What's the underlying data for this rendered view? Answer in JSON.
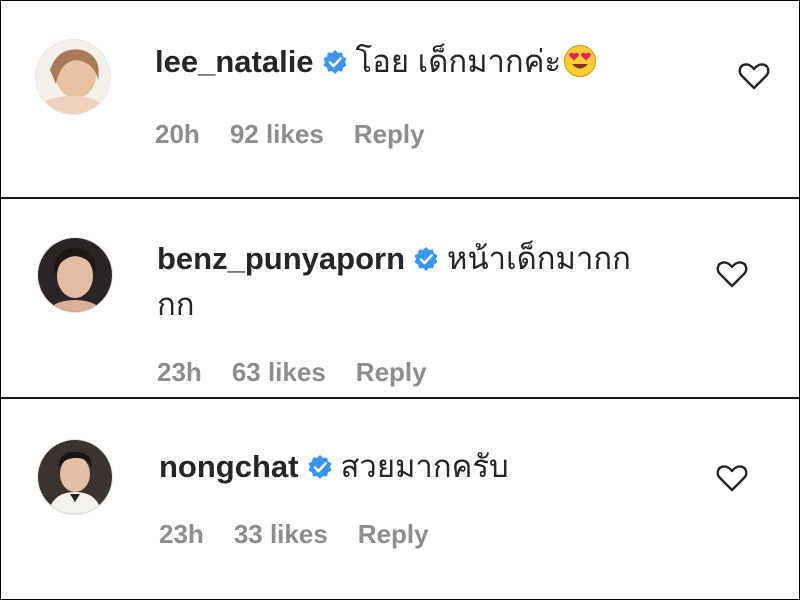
{
  "comments": [
    {
      "username": "lee_natalie",
      "verified": true,
      "text_line1": "โอย เด็กมากค่ะ",
      "text_line2": "",
      "emoji": "heart-eyes-emoji",
      "time": "20h",
      "likes": "92 likes",
      "reply": "Reply"
    },
    {
      "username": "benz_punyaporn",
      "verified": true,
      "text_line1": "หน้าเด็กมากก",
      "text_line2": "กก",
      "emoji": "",
      "time": "23h",
      "likes": "63 likes",
      "reply": "Reply"
    },
    {
      "username": "nongchat",
      "verified": true,
      "text_line1": "สวยมากครับ",
      "text_line2": "",
      "emoji": "",
      "time": "23h",
      "likes": "33 likes",
      "reply": "Reply"
    }
  ],
  "colors": {
    "verified_badge": "#3897f0",
    "meta_text": "#8e8e8e",
    "primary_text": "#262626"
  },
  "icons": {
    "verified": "verified-badge-icon",
    "like": "heart-outline-icon"
  }
}
